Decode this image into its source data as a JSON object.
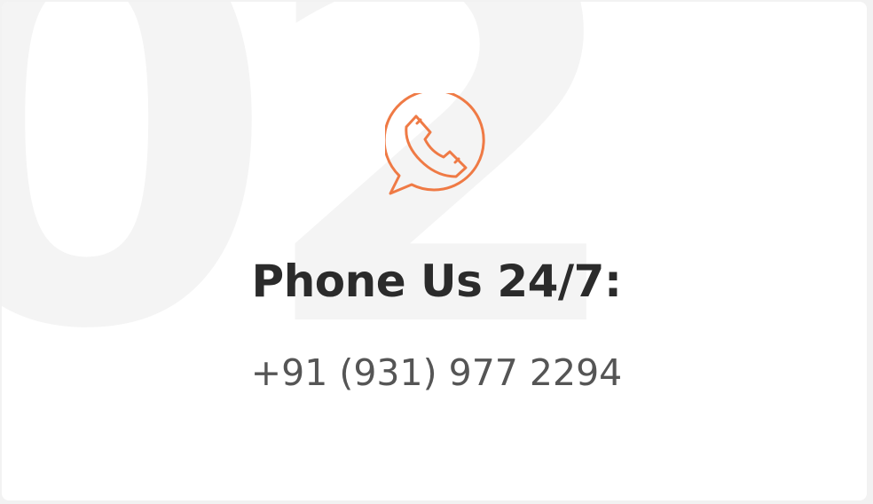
{
  "card": {
    "watermark": "02",
    "icon": "phone-chat-bubble-icon",
    "title": "Phone Us 24/7:",
    "phone": "+91 (931) 977 2294"
  },
  "colors": {
    "accent": "#ef7a45",
    "title": "#2b2b2b",
    "text": "#555555",
    "watermark": "#f4f4f4"
  }
}
